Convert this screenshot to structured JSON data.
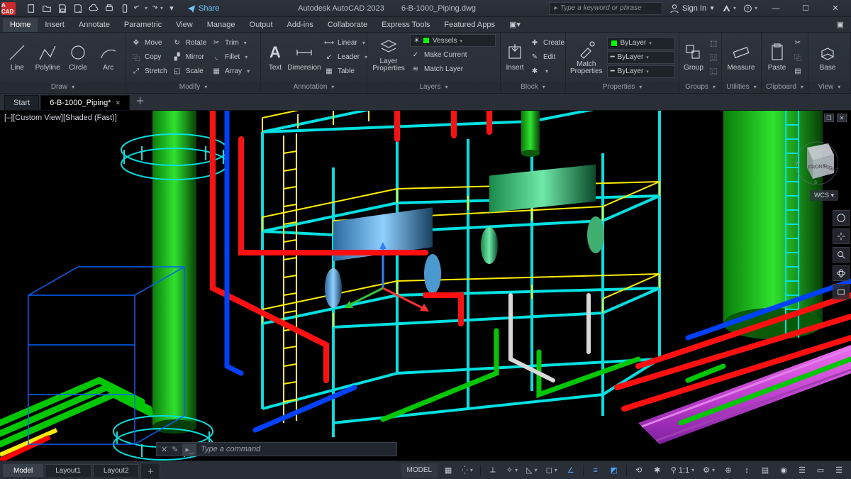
{
  "app": {
    "logo": "A CAD",
    "title": "Autodesk AutoCAD 2023",
    "document": "6-B-1000_Piping.dwg",
    "share": "Share",
    "search_placeholder": "Type a keyword or phrase",
    "signin": "Sign In"
  },
  "qat": [
    "new",
    "open",
    "save",
    "saveas",
    "plot",
    "undo",
    "redo"
  ],
  "ribbon_tabs": [
    "Home",
    "Insert",
    "Annotate",
    "Parametric",
    "View",
    "Manage",
    "Output",
    "Add-ins",
    "Collaborate",
    "Express Tools",
    "Featured Apps"
  ],
  "ribbon_active": "Home",
  "panels": {
    "draw": {
      "title": "Draw",
      "items": [
        "Line",
        "Polyline",
        "Circle",
        "Arc"
      ]
    },
    "modify": {
      "title": "Modify",
      "rows": [
        [
          "Move",
          "Rotate",
          "Trim"
        ],
        [
          "Copy",
          "Mirror",
          "Fillet"
        ],
        [
          "Stretch",
          "Scale",
          "Array"
        ]
      ]
    },
    "annotation": {
      "title": "Annotation",
      "text": "Text",
      "dimension": "Dimension",
      "rows": [
        "Linear",
        "Leader",
        "Table"
      ]
    },
    "layers": {
      "title": "Layers",
      "layer_props": "Layer\nProperties",
      "current_layer": "Vessels",
      "rows": [
        "Make Current",
        "Match Layer"
      ]
    },
    "block": {
      "title": "Block",
      "insert": "Insert",
      "rows": [
        "Create",
        "Edit",
        ""
      ]
    },
    "properties": {
      "title": "Properties",
      "match": "Match\nProperties",
      "color_label": "ByLayer",
      "lw_label": "ByLayer",
      "lt_label": "ByLayer"
    },
    "groups": {
      "title": "Groups",
      "label": "Group"
    },
    "utilities": {
      "title": "Utilities",
      "label": "Measure"
    },
    "clipboard": {
      "title": "Clipboard",
      "label": "Paste"
    },
    "view": {
      "title": "View",
      "label": "Base"
    }
  },
  "file_tabs": {
    "start": "Start",
    "active": "6-B-1000_Piping*"
  },
  "viewport": {
    "label": "[–][Custom View][Shaded (Fast)]",
    "wcs": "WCS",
    "cube_front": "FRONT",
    "cube_right": "RIGHT"
  },
  "layout_tabs": [
    "Model",
    "Layout1",
    "Layout2"
  ],
  "command": {
    "placeholder": "Type a command"
  },
  "status": {
    "model": "MODEL",
    "scale": "1:1"
  }
}
